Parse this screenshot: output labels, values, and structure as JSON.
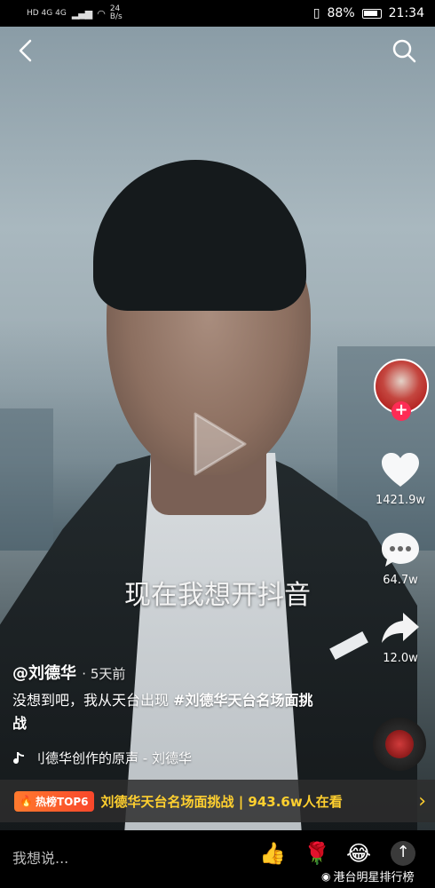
{
  "status_bar": {
    "network_left": "HD 4G 4G",
    "speed": "24\nB/s",
    "battery": "88%",
    "time": "21:34"
  },
  "video": {
    "subtitle": "现在我想开抖音"
  },
  "nav": {
    "back_icon": "chevron-left-icon",
    "search_icon": "search-icon"
  },
  "actions": {
    "like_count": "1421.9w",
    "comment_count": "64.7w",
    "share_count": "12.0w"
  },
  "post": {
    "author": "@刘德华",
    "time": "· 5天前",
    "caption_text": "没想到吧，我从天台出现 ",
    "caption_tag": "#刘德华天台名场面挑战",
    "music": "刂德华创作的原声 - 刘德华"
  },
  "hot": {
    "badge": "热榜TOP6",
    "text": "刘德华天台名场面挑战 | 943.6w人在看"
  },
  "bottom": {
    "placeholder": "我想说...",
    "watermark": "港台明星排行榜"
  },
  "colors": {
    "accent_red": "#fe2c55",
    "hot_yellow": "#ffd02f"
  }
}
